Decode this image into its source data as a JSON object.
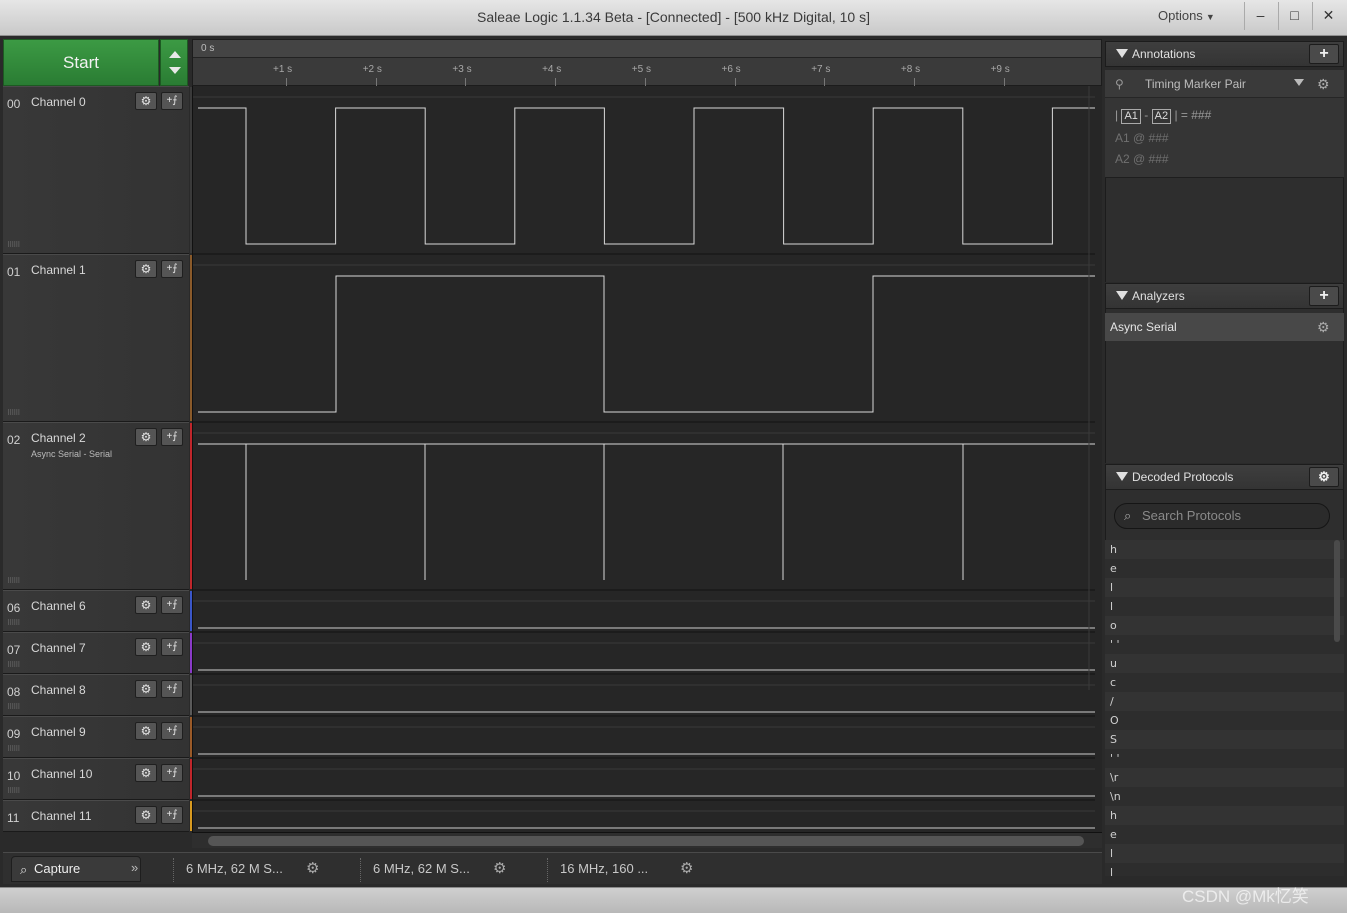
{
  "window": {
    "title": "Saleae Logic 1.1.34 Beta - [Connected] - [500 kHz Digital, 10 s]",
    "options_label": "Options",
    "minimize": "–",
    "maximize": "□",
    "close": "✕"
  },
  "start_label": "Start",
  "ruler": {
    "zero_label": "0 s",
    "ticks": [
      "+1 s",
      "+2 s",
      "+3 s",
      "+4 s",
      "+5 s",
      "+6 s",
      "+7 s",
      "+8 s",
      "+9 s"
    ]
  },
  "channels": [
    {
      "num": "00",
      "name": "Channel 0",
      "sub": "",
      "color": "#3a3a3a"
    },
    {
      "num": "01",
      "name": "Channel 1",
      "sub": "",
      "color": "#8a5a2a"
    },
    {
      "num": "02",
      "name": "Channel 2",
      "sub": "Async Serial - Serial",
      "color": "#c0262b"
    },
    {
      "num": "06",
      "name": "Channel 6",
      "sub": "",
      "color": "#3a56c8"
    },
    {
      "num": "07",
      "name": "Channel 7",
      "sub": "",
      "color": "#8a3ac8"
    },
    {
      "num": "08",
      "name": "Channel 8",
      "sub": "",
      "color": "#5a5a5a"
    },
    {
      "num": "09",
      "name": "Channel 9",
      "sub": "",
      "color": "#9a5a28"
    },
    {
      "num": "10",
      "name": "Channel 10",
      "sub": "",
      "color": "#c0262b"
    },
    {
      "num": "11",
      "name": "Channel 11",
      "sub": "",
      "color": "#d89a20"
    }
  ],
  "tabs": {
    "capture": "Capture",
    "more": "»",
    "sessions": [
      "6 MHz, 62 M S...",
      "6 MHz, 62 M S...",
      "16 MHz, 160 ..."
    ]
  },
  "annotations": {
    "header": "Annotations",
    "add": "+",
    "marker_pair_label": "Timing Marker Pair",
    "pin_icon": "pin-icon",
    "expr_line": {
      "open": "|",
      "a1": "A1",
      "dash": "-",
      "a2": "A2",
      "close": "| = ###"
    },
    "a1_line": "A1  @  ###",
    "a2_line": "A2  @  ###"
  },
  "analyzers": {
    "header": "Analyzers",
    "add": "+",
    "items": [
      "Async Serial"
    ]
  },
  "decoded": {
    "header": "Decoded Protocols",
    "search_placeholder": "Search Protocols",
    "items": [
      "h",
      "e",
      "l",
      "l",
      "o",
      "' '",
      "u",
      "c",
      "/",
      "O",
      "S",
      "' '",
      "\\r",
      "\\n",
      "h",
      "e",
      "l",
      "l"
    ]
  },
  "watermark": "CSDN @Mk忆笑"
}
